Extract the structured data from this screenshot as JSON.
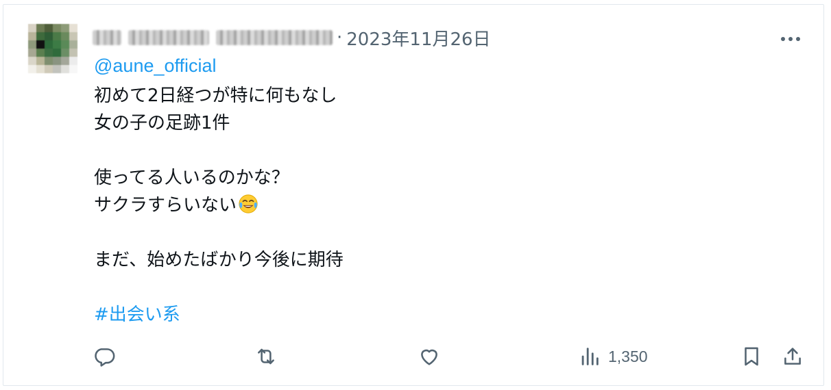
{
  "tweet": {
    "author_name": "",
    "author_handle": "",
    "date_separator": "·",
    "date": "2023年11月26日",
    "reply_to": "@aune_official",
    "body_lines": [
      "初めて2日経つが特に何もなし",
      "女の子の足跡1件",
      "",
      "使ってる人いるのかな？",
      "サクラすらいない",
      "",
      "まだ、始めたばかり今後に期待",
      ""
    ],
    "emoji": "face-with-tears-of-joy",
    "hashtag": "#出会い系",
    "views": "1,350"
  },
  "colors": {
    "accent": "#1d9bf0",
    "text": "#0f1419",
    "muted": "#536471",
    "border": "#e1e8ed"
  },
  "icons": {
    "more": "more-horizontal-icon",
    "reply": "reply-icon",
    "retweet": "retweet-icon",
    "like": "heart-icon",
    "views": "analytics-icon",
    "bookmark": "bookmark-icon",
    "share": "share-icon"
  }
}
